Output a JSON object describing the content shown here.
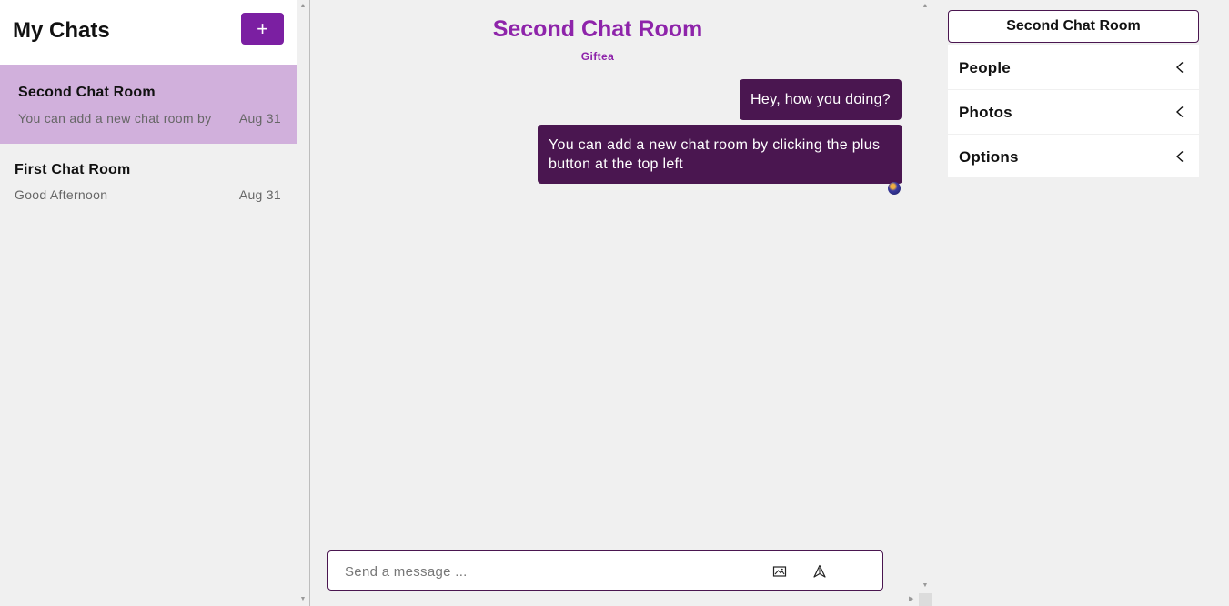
{
  "sidebar": {
    "title": "My Chats",
    "new_chat_label": "+",
    "chats": [
      {
        "name": "Second Chat Room",
        "preview": "You can add a new chat room by clicking the plus button at the top left",
        "date": "Aug 31",
        "active": true
      },
      {
        "name": "First Chat Room",
        "preview": "Good Afternoon",
        "date": "Aug 31",
        "active": false
      }
    ]
  },
  "main": {
    "room_title": "Second Chat Room",
    "room_subtitle": "Giftea",
    "messages": [
      {
        "text": "Hey, how you doing?"
      },
      {
        "text": "You can add a new chat room by clicking the plus button at the top left"
      }
    ],
    "composer": {
      "placeholder": "Send a message ..."
    }
  },
  "panel": {
    "title": "Second Chat Room",
    "sections": [
      {
        "label": "People"
      },
      {
        "label": "Photos"
      },
      {
        "label": "Options"
      }
    ]
  },
  "colors": {
    "accent": "#7b1fa2",
    "title": "#8e24aa",
    "bubble": "#4a1650",
    "active_chat": "#d1b0dc"
  }
}
